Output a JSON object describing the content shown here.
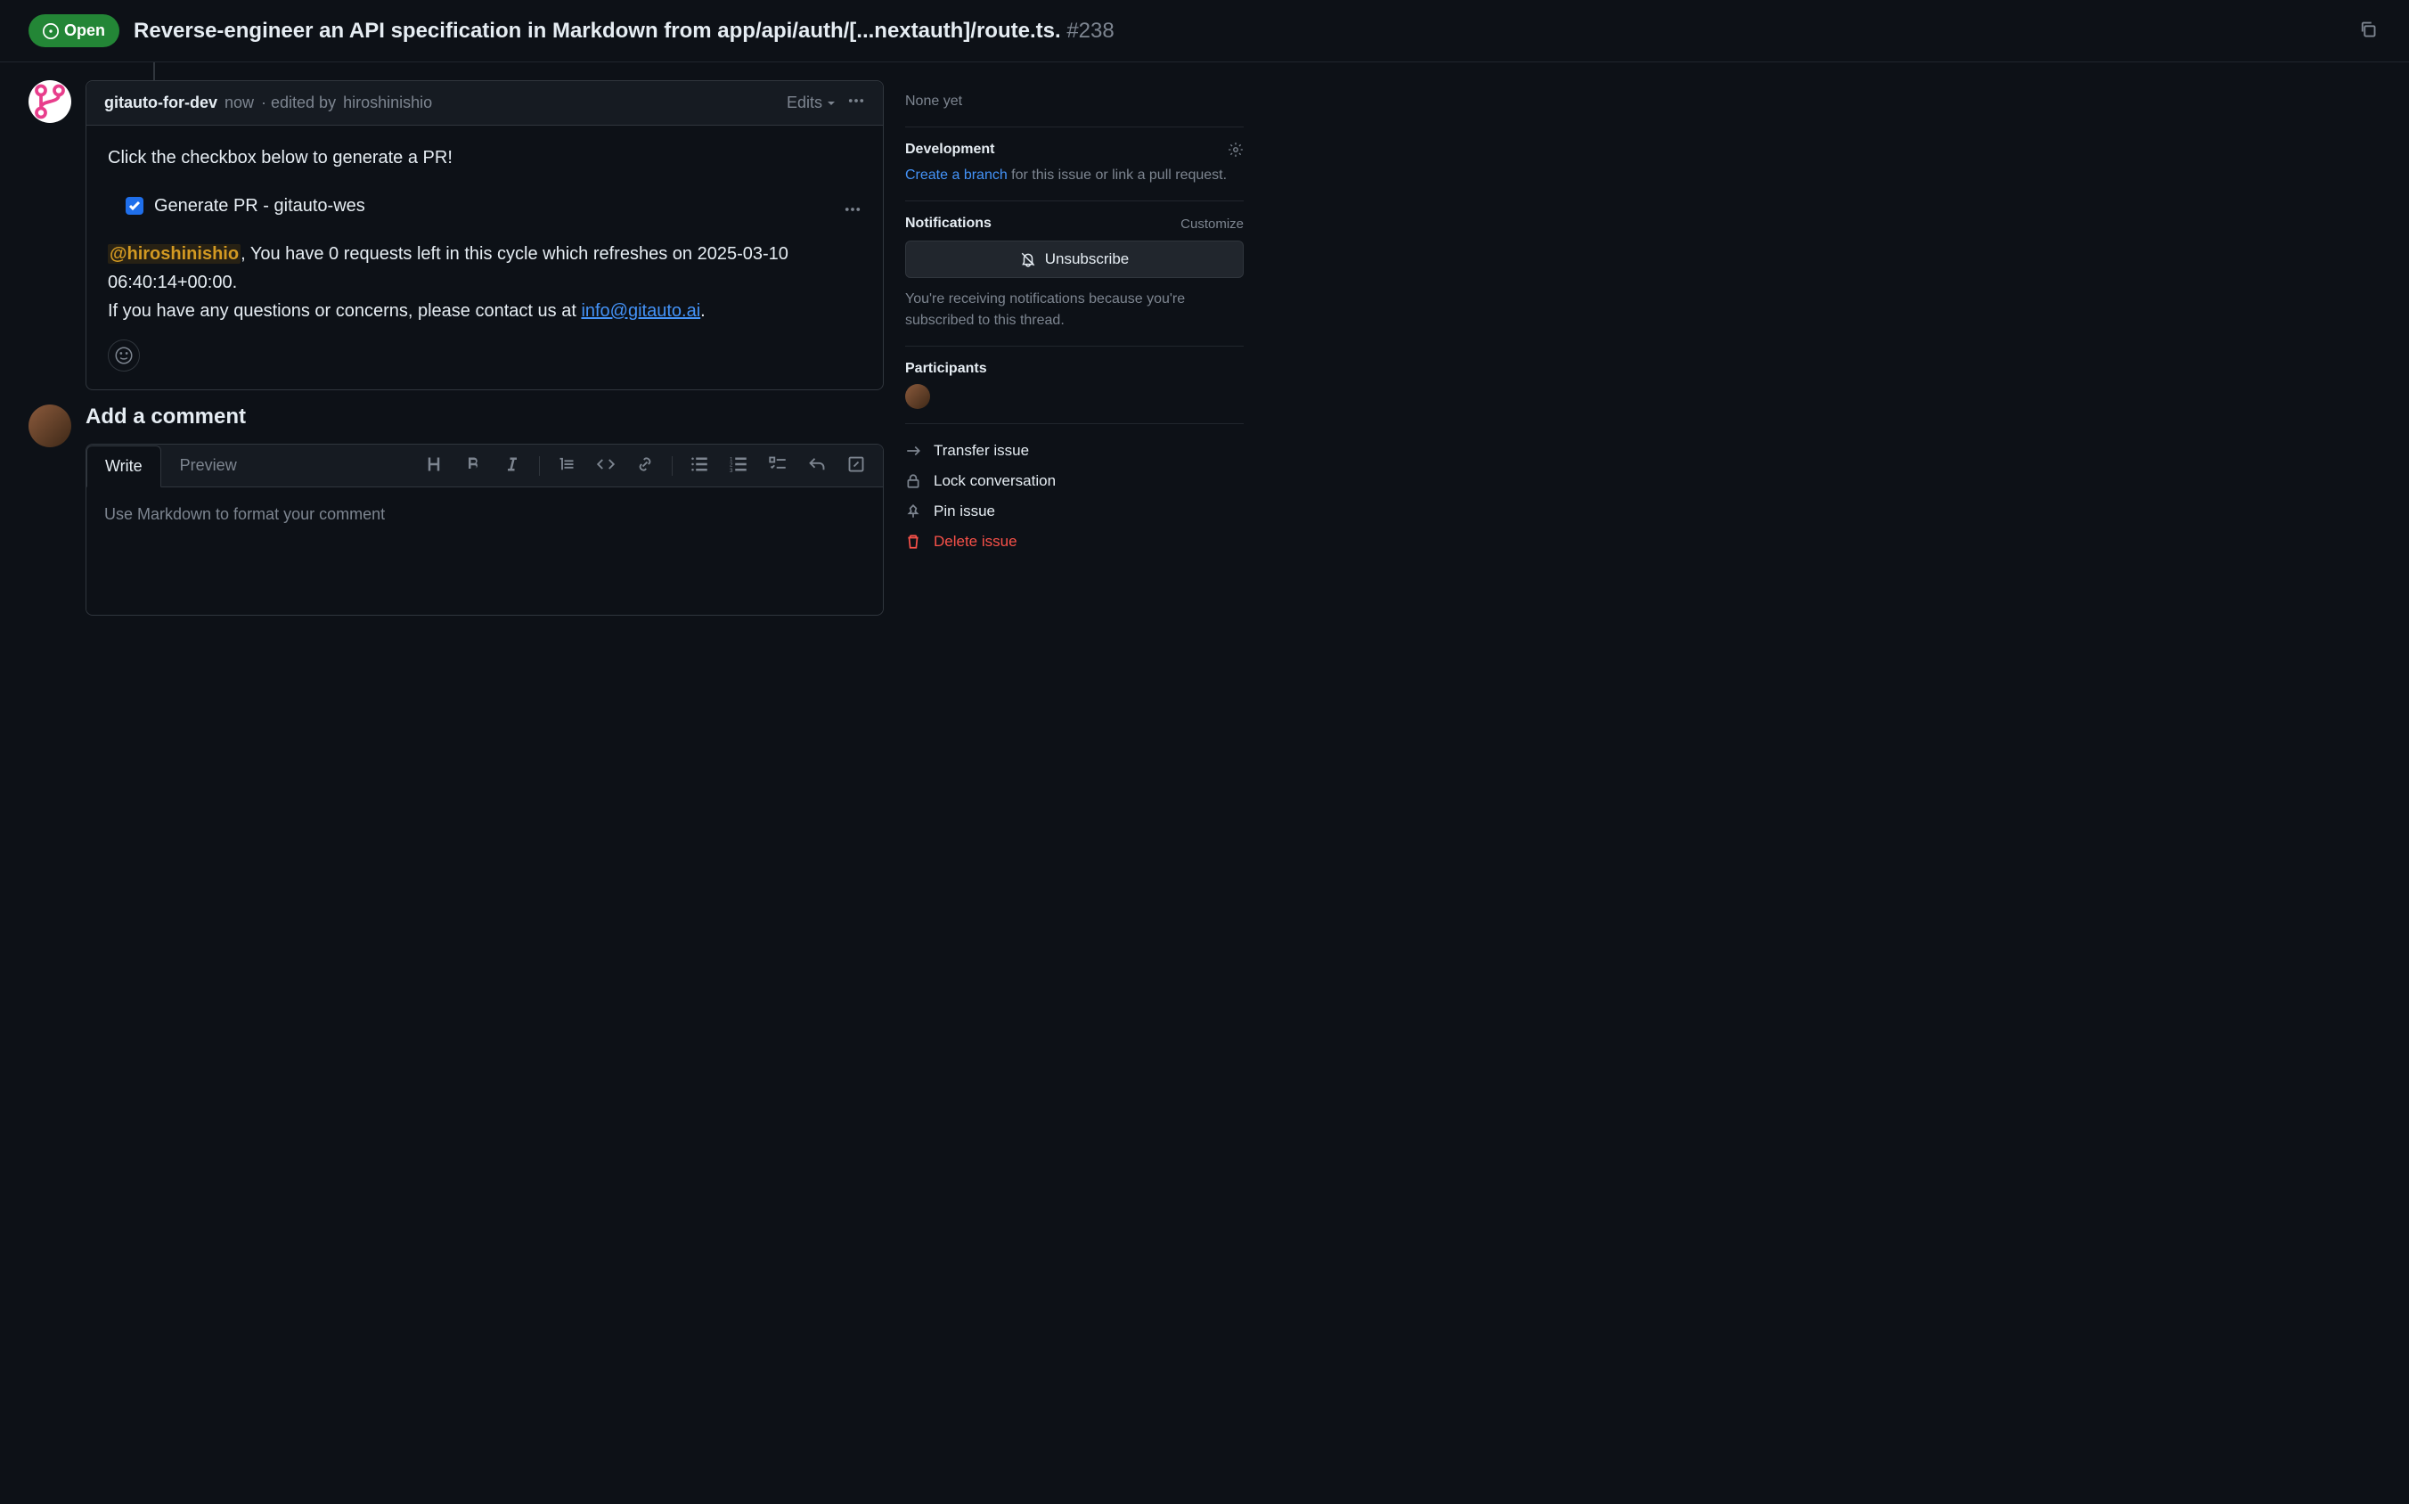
{
  "header": {
    "state": "Open",
    "title": "Reverse-engineer an API specification in Markdown from app/api/auth/[...nextauth]/route.ts.",
    "issue_number": "#238"
  },
  "comment": {
    "author": "gitauto-for-dev",
    "time": "now",
    "edited_prefix": "· edited by",
    "edited_by": "hiroshinishio",
    "edits_label": "Edits",
    "body_intro": "Click the checkbox below to generate a PR!",
    "checkbox_label": "Generate PR - gitauto-wes",
    "mention": "@hiroshinishio",
    "body_line1_after": ", You have 0 requests left in this cycle which refreshes on 2025-03-10 06:40:14+00:00.",
    "body_line2_prefix": "If you have any questions or concerns, please contact us at ",
    "contact_link": "info@gitauto.ai",
    "body_line2_suffix": "."
  },
  "add_comment": {
    "title": "Add a comment",
    "tab_write": "Write",
    "tab_preview": "Preview",
    "placeholder": "Use Markdown to format your comment"
  },
  "sidebar": {
    "none_yet": "None yet",
    "development": {
      "heading": "Development",
      "link_text": "Create a branch",
      "text_after": " for this issue or link a pull request."
    },
    "notifications": {
      "heading": "Notifications",
      "customize": "Customize",
      "button": "Unsubscribe",
      "reason": "You're receiving notifications because you're subscribed to this thread."
    },
    "participants": {
      "heading": "Participants"
    },
    "actions": {
      "transfer": "Transfer issue",
      "lock": "Lock conversation",
      "pin": "Pin issue",
      "delete": "Delete issue"
    }
  }
}
